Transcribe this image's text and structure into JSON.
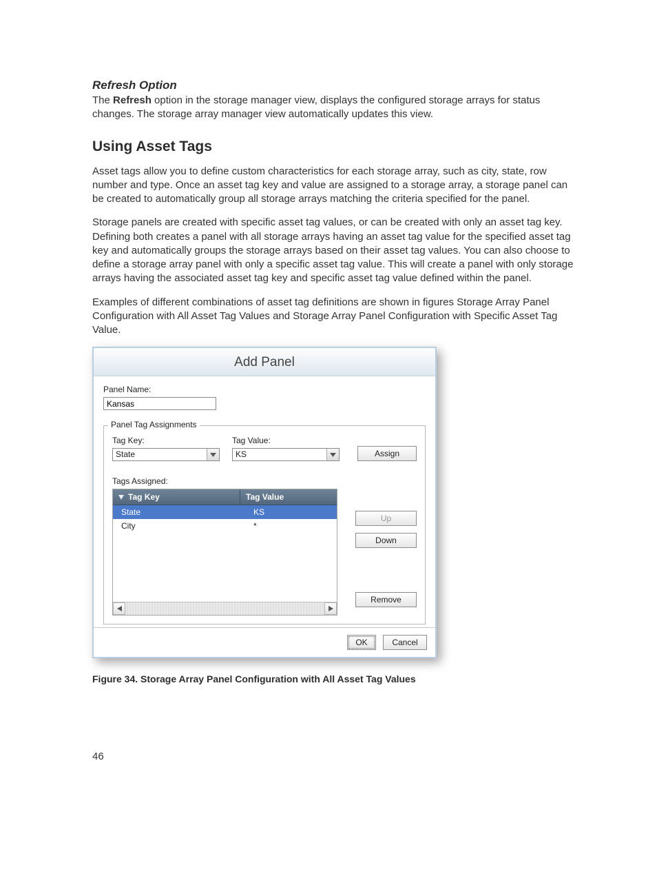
{
  "refresh": {
    "heading": "Refresh Option",
    "text_prefix": "The ",
    "bold_word": "Refresh",
    "text_suffix": " option in the storage manager view, displays the configured storage arrays for status changes. The storage array manager view automatically updates this view."
  },
  "section_title": "Using Asset Tags",
  "paragraphs": {
    "p1": "Asset tags allow you to define custom characteristics for each storage array, such as city, state, row number and type. Once an asset tag key and value are assigned to a storage array, a storage panel can be created to automatically group all storage arrays matching the criteria specified for the panel.",
    "p2": "Storage panels are created with specific asset tag values, or can be created with only an asset tag key. Defining both creates a panel with all storage arrays having an asset tag value for the specified asset tag key and automatically groups the storage arrays based on their asset tag values. You can also choose to define a storage array panel with only a specific asset tag value. This will create a panel with only storage arrays having the associated asset tag key and specific asset tag value defined within the panel.",
    "p3": "Examples of different combinations of asset tag definitions are shown in figures Storage Array Panel Configuration with All Asset Tag Values and Storage Array Panel Configuration with Specific Asset Tag Value."
  },
  "dialog": {
    "title": "Add Panel",
    "panel_name_label": "Panel Name:",
    "panel_name_value": "Kansas",
    "fieldset_legend": "Panel Tag Assignments",
    "tag_key_label": "Tag Key:",
    "tag_key_value": "State",
    "tag_value_label": "Tag Value:",
    "tag_value_value": "KS",
    "assign_btn": "Assign",
    "tags_assigned_label": "Tags Assigned:",
    "table": {
      "col_key": "Tag Key",
      "col_val": "Tag Value",
      "rows": [
        {
          "key": "State",
          "value": "KS",
          "selected": true
        },
        {
          "key": "City",
          "value": "*",
          "selected": false
        }
      ]
    },
    "up_btn": "Up",
    "down_btn": "Down",
    "remove_btn": "Remove",
    "ok_btn": "OK",
    "cancel_btn": "Cancel"
  },
  "figure_caption": "Figure 34. Storage Array Panel Configuration with All Asset Tag Values",
  "page_number": "46"
}
